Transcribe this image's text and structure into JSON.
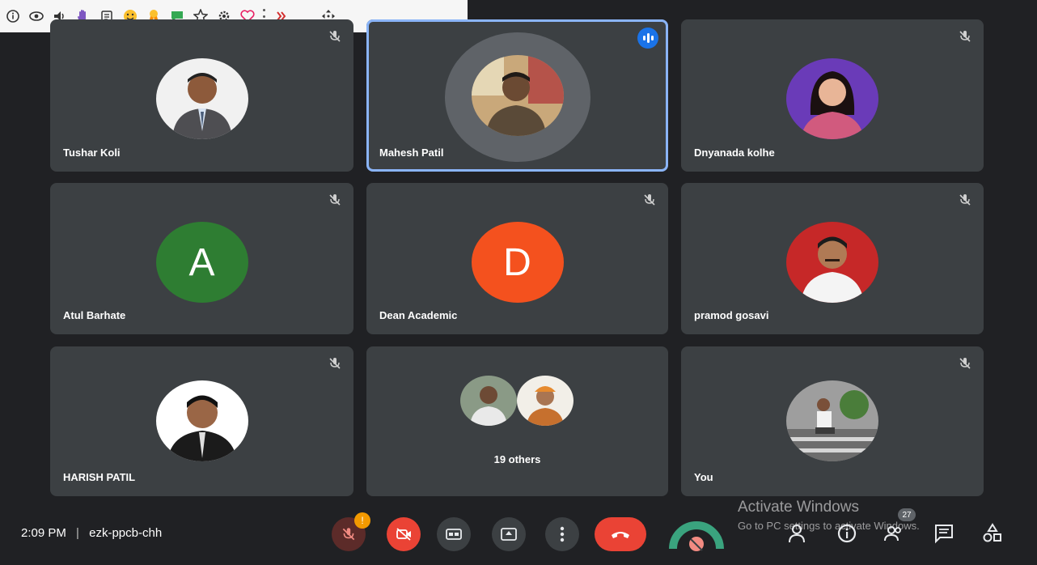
{
  "toolbar": {
    "icons": [
      "info-icon",
      "eye-icon",
      "speaker-icon",
      "hand-icon",
      "clipboard-icon",
      "smiley-icon",
      "ribbon-icon",
      "chat-bubble-icon",
      "star-icon",
      "gear-icon",
      "heart-icon",
      "more-icon",
      "chevrons-icon",
      "minimize-icon",
      "move-icon"
    ]
  },
  "participants": [
    {
      "name": "Tushar Koli",
      "type": "photo"
    },
    {
      "name": "Mahesh Patil",
      "type": "photo",
      "speaking": true
    },
    {
      "name": "Dnyanada kolhe",
      "type": "photo"
    },
    {
      "name": "Atul Barhate",
      "type": "letter",
      "letter": "A",
      "color": "#2e7d32"
    },
    {
      "name": "Dean Academic",
      "type": "letter",
      "letter": "D",
      "color": "#f4511e"
    },
    {
      "name": "pramod gosavi",
      "type": "photo"
    },
    {
      "name": "HARISH PATIL",
      "type": "photo"
    },
    {
      "name": "19 others",
      "type": "group"
    },
    {
      "name": "You",
      "type": "photo"
    }
  ],
  "meeting": {
    "time": "2:09 PM",
    "separator": "|",
    "code": "ezk-ppcb-chh"
  },
  "controls": {
    "mic_badge": "!",
    "people_count": "27"
  },
  "watermark": {
    "title": "Activate Windows",
    "subtitle": "Go to PC settings to activate Windows."
  },
  "colors": {
    "background": "#202124",
    "tile": "#3c4043",
    "active_outline": "#8ab4f8",
    "end_call": "#ea4335",
    "badge": "#f29900"
  }
}
